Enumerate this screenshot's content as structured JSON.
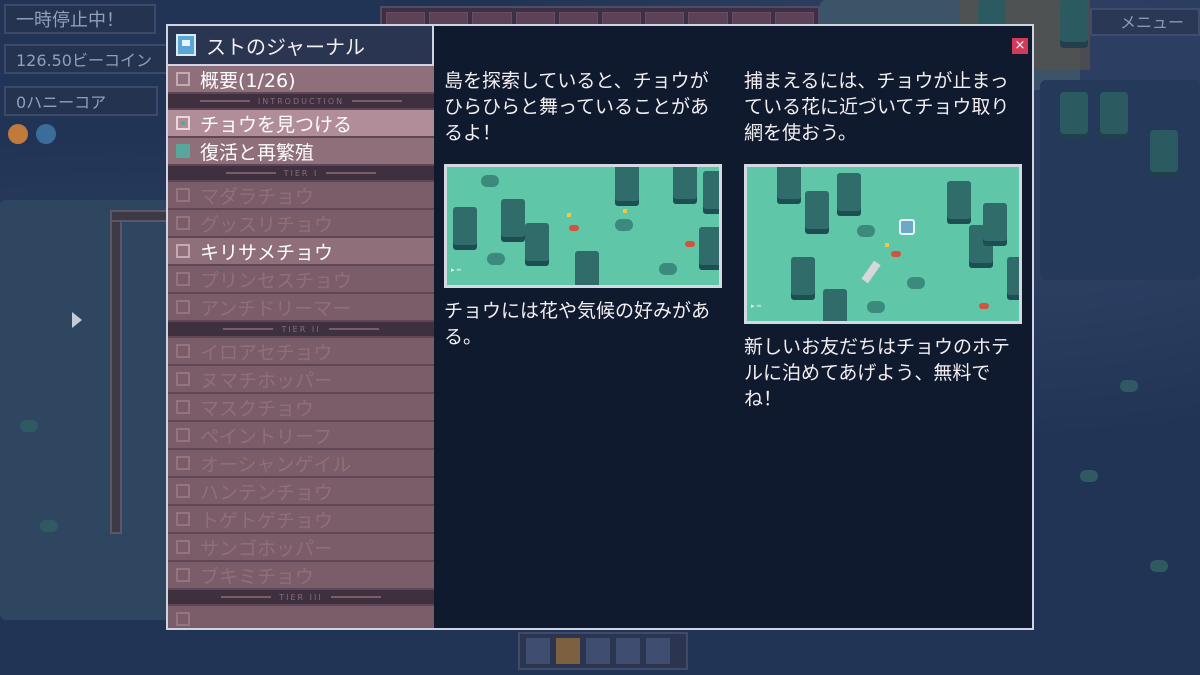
{
  "hud": {
    "paused": "一時停止中！",
    "currency": "126.50ビーコイン",
    "honeycore": "0ハニーコア",
    "menu": "メニュー"
  },
  "journal": {
    "title": "ストのジャーナル",
    "close_label": "×",
    "dividers": [
      "INTRODUCTION",
      "TIER I",
      "TIER II",
      "TIER III"
    ],
    "overview": "概要(1/26)",
    "intro_items": [
      {
        "label": "チョウを見つける"
      },
      {
        "label": "復活と再繁殖"
      }
    ],
    "tier1_items": [
      {
        "label": "マダラチョウ"
      },
      {
        "label": "グッスリチョウ"
      },
      {
        "label": "キリサメチョウ"
      },
      {
        "label": "プリンセスチョウ"
      },
      {
        "label": "アンチドリーマー"
      }
    ],
    "tier2_items": [
      {
        "label": "イロアセチョウ"
      },
      {
        "label": "ヌマチホッパー"
      },
      {
        "label": "マスクチョウ"
      },
      {
        "label": "ペイントリーフ"
      },
      {
        "label": "オーシャンゲイル"
      },
      {
        "label": "ハンテンチョウ"
      },
      {
        "label": "トゲトゲチョウ"
      },
      {
        "label": "サンゴホッパー"
      },
      {
        "label": "ブキミチョウ"
      }
    ]
  },
  "content": {
    "col1_top": "島を探索していると、チョウがひらひらと舞っていることがあるよ！",
    "col1_bottom": "チョウには花や気候の好みがある。",
    "col2_top": "捕まえるには、チョウが止まっている花に近づいてチョウ取り網を使おう。",
    "col2_bottom": "新しいお友だちはチョウのホテルに泊めてあげよう、無料でね！"
  },
  "colors": {
    "window_bg": "#101a2e",
    "sidebar_row": "#8e6f7a",
    "sidebar_row_dim": "#7a5d68",
    "accent_green": "#59a69a",
    "close_red": "#d23a5a",
    "grass": "#5fc7a7"
  },
  "icons": [
    "journal-book-icon",
    "close-icon",
    "checkbox-icon",
    "menu-icon",
    "cursor-icon"
  ]
}
